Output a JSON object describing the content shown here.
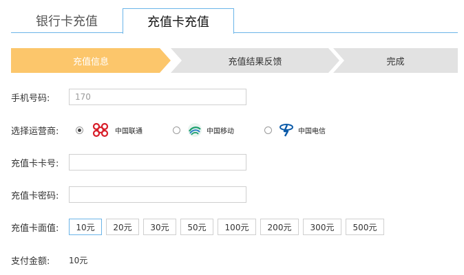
{
  "tabs": [
    {
      "label": "银行卡充值",
      "active": false
    },
    {
      "label": "充值卡充值",
      "active": true
    }
  ],
  "steps": [
    {
      "label": "充值信息",
      "current": true
    },
    {
      "label": "充值结果反馈",
      "current": false
    },
    {
      "label": "完成",
      "current": false
    }
  ],
  "form": {
    "phone": {
      "label": "手机号码:",
      "placeholder": "170"
    },
    "carrier": {
      "label": "选择运营商:",
      "options": [
        {
          "name": "中国联通",
          "icon": "china-unicom-logo",
          "selected": true
        },
        {
          "name": "中国移动",
          "icon": "china-mobile-logo",
          "selected": false
        },
        {
          "name": "中国电信",
          "icon": "china-telecom-logo",
          "selected": false
        }
      ]
    },
    "card_number": {
      "label": "充值卡卡号:",
      "value": ""
    },
    "card_password": {
      "label": "充值卡密码:",
      "value": ""
    },
    "face_value": {
      "label": "充值卡面值:",
      "options": [
        "10元",
        "20元",
        "30元",
        "50元",
        "100元",
        "200元",
        "300元",
        "500元"
      ],
      "selected": "10元"
    },
    "payment": {
      "label": "支付金额:",
      "value": "10元"
    }
  },
  "colors": {
    "accent": "#6ab4e8",
    "step_active": "#fcc66b",
    "step_inactive": "#e2e2e2"
  }
}
